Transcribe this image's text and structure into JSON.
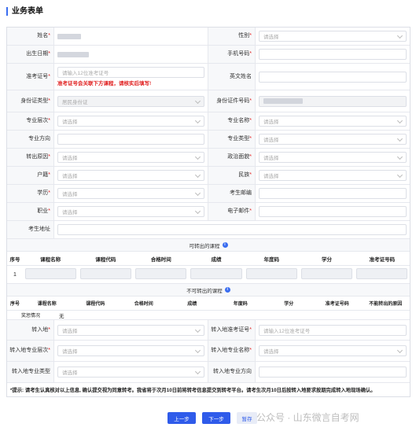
{
  "page": {
    "title": "业务表单"
  },
  "fields": {
    "name": "姓名",
    "gender": "性别",
    "gender_ph": "请选择",
    "birth": "出生日期",
    "phone": "手机号码",
    "exam_no": "准考证号",
    "exam_no_ph": "请输入12位准考证号",
    "exam_warn": "准考证号会关联下方课程，请核实后填写!",
    "en_name": "英文姓名",
    "id_type": "身份证类型",
    "id_type_ph": "居民身份证",
    "id_no": "身份证件号码",
    "level": "专业层次",
    "major_name": "专业名称",
    "major_dir": "专业方向",
    "major_type": "专业类型",
    "reason": "转出原因",
    "politics": "政治面貌",
    "hukou": "户籍",
    "ethnic": "民族",
    "edu": "学历",
    "postcode": "考生邮编",
    "job": "职业",
    "email": "电子邮件",
    "address": "考生地址",
    "select_ph": "请选择"
  },
  "transfer_table": {
    "title": "可转出的课程",
    "headers": [
      "序号",
      "课程名称",
      "课程代码",
      "合格时间",
      "成绩",
      "年度码",
      "学分",
      "准考证号码"
    ],
    "rows": [
      [
        "1"
      ]
    ]
  },
  "nontransfer_table": {
    "title": "不可转出的课程",
    "headers": [
      "序号",
      "课程名称",
      "课程代码",
      "合格时间",
      "成绩",
      "年度码",
      "学分",
      "准考证号码",
      "不能转出的原因"
    ],
    "extra_label": "奖惩情况",
    "extra_value": "无"
  },
  "transfer_in": {
    "dest": "转入地",
    "dest_exam_no": "转入地准考证号",
    "dest_exam_ph": "请输入12位准考证号",
    "dest_level": "转入地专业层次",
    "dest_major": "转入地专业名称",
    "dest_type": "转入地专业类型",
    "dest_dir": "转入地专业方向"
  },
  "note": "*提示: 请考生认真核对以上信息, 确认提交视为同意转考。我省将于次月10日前将转考信息提交到转考平台。请考生次月10日后按转入地要求按期完成转入地现场确认。",
  "buttons": {
    "prev": "上一步",
    "next": "下一步",
    "save": "暂存"
  },
  "watermark": "公众号 · 山东微言自考网"
}
